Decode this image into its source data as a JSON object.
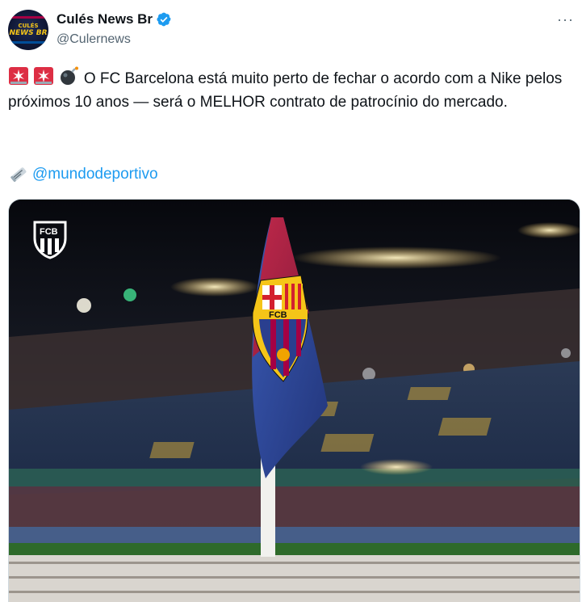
{
  "tweet": {
    "author_name": "Culés News Br",
    "handle": "@Culernews",
    "avatar_text_top": "CULÉS",
    "avatar_text_bottom": "NEWS BR",
    "more_label": "···",
    "body": "O FC Barcelona está muito perto de fechar o acordo com a Nike pelos próximos 10 anos — será o MELHOR contrato de patrocínio do mercado.",
    "emojis": [
      "rotating-light-emoji",
      "rotating-light-emoji",
      "bomb-emoji"
    ],
    "mention_emoji": "newspaper-roll-emoji",
    "mention": "@mundodeportivo"
  },
  "media": {
    "logo_text": "FCB",
    "flag_crest_text": "FCB"
  },
  "colors": {
    "link": "#1d9bf0",
    "verified": "#1d9bf0",
    "secondary_text": "#536471"
  }
}
